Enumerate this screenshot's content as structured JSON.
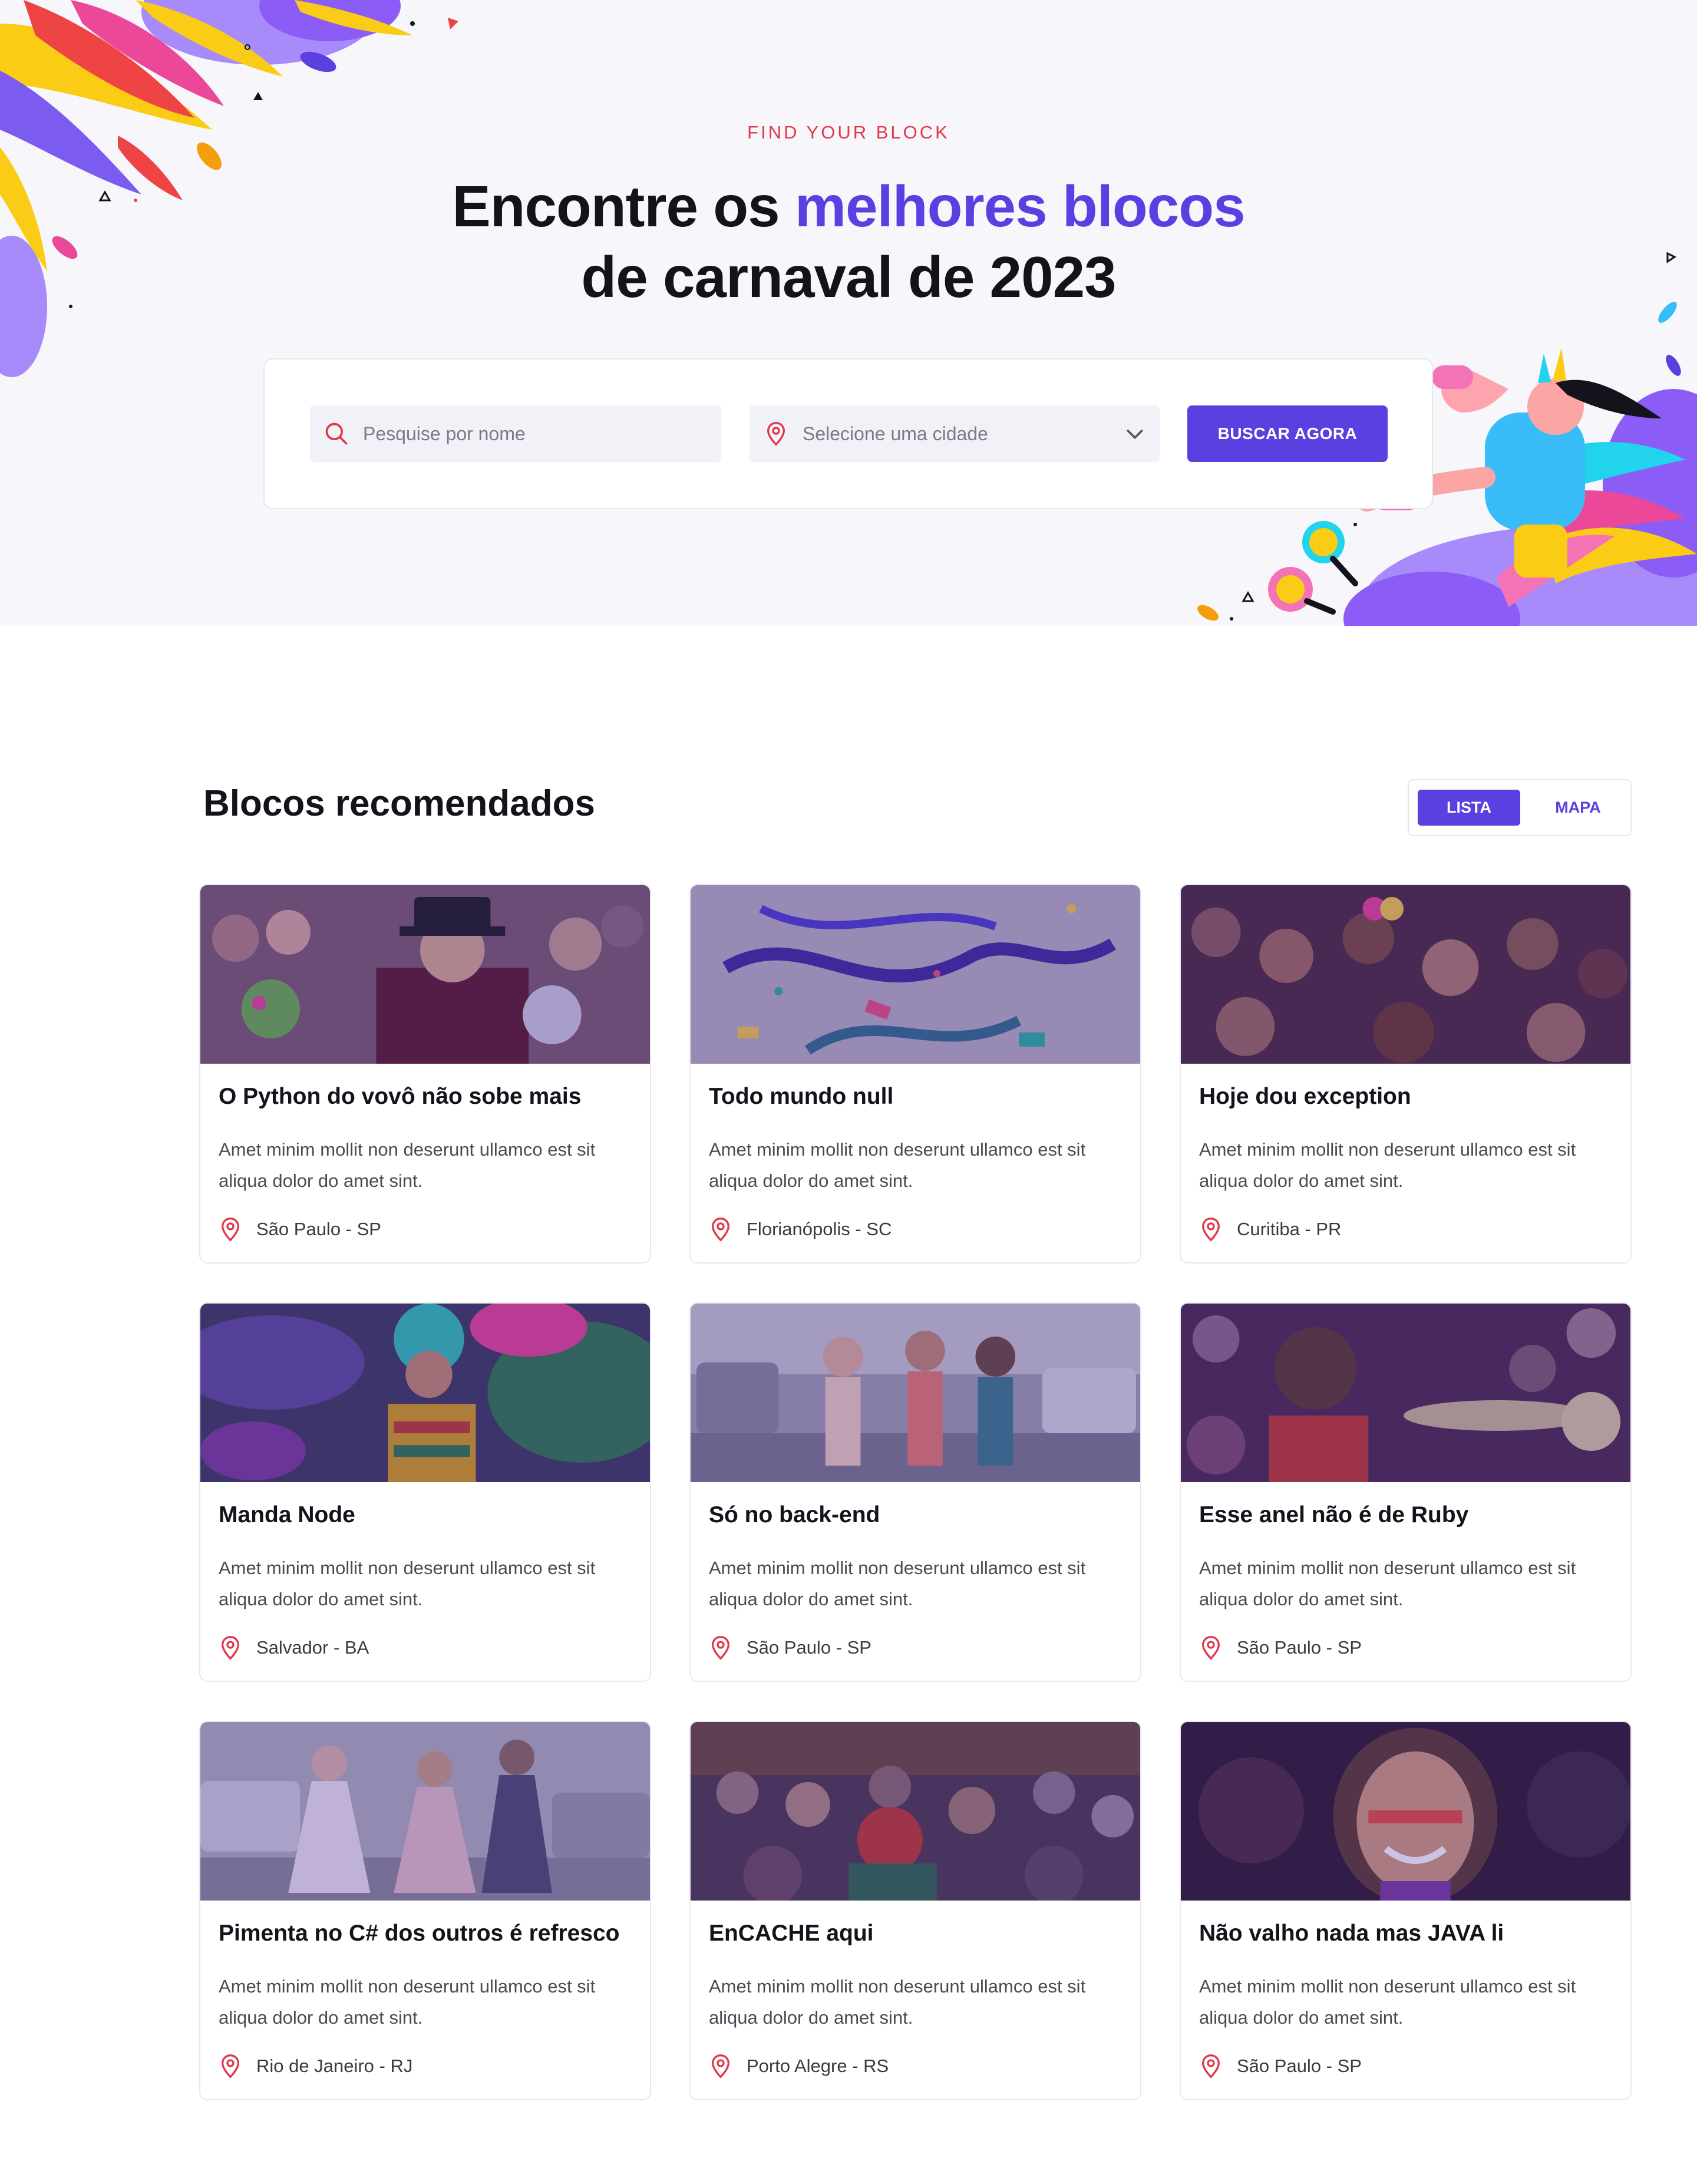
{
  "hero": {
    "eyebrow": "FIND YOUR BLOCK",
    "title_part1": "Encontre os ",
    "title_accent": "melhores blocos",
    "title_line2": "de carnaval de 2023"
  },
  "search": {
    "name_placeholder": "Pesquise por nome",
    "city_placeholder": "Selecione uma cidade",
    "button_label": "BUSCAR AGORA"
  },
  "section": {
    "title": "Blocos recomendados",
    "view_list": "LISTA",
    "view_map": "MAPA"
  },
  "colors": {
    "accent": "#5b3fe0",
    "eyebrow": "#e0384b",
    "pin": "#e0384b"
  },
  "blocks": [
    {
      "title": "O Python do vovô não sobe mais",
      "description": "Amet minim mollit non deserunt ullamco est sit aliqua dolor do amet sint.",
      "location": "São Paulo - SP"
    },
    {
      "title": "Todo mundo null",
      "description": "Amet minim mollit non deserunt ullamco est sit aliqua dolor do amet sint.",
      "location": "Florianópolis - SC"
    },
    {
      "title": "Hoje dou exception",
      "description": "Amet minim mollit non deserunt ullamco est sit aliqua dolor do amet sint.",
      "location": "Curitiba - PR"
    },
    {
      "title": "Manda Node",
      "description": "Amet minim mollit non deserunt ullamco est sit aliqua dolor do amet sint.",
      "location": "Salvador - BA"
    },
    {
      "title": "Só no back-end",
      "description": "Amet minim mollit non deserunt ullamco est sit aliqua dolor do amet sint.",
      "location": "São Paulo - SP"
    },
    {
      "title": "Esse anel não é de Ruby",
      "description": "Amet minim mollit non deserunt ullamco est sit aliqua dolor do amet sint.",
      "location": "São Paulo - SP"
    },
    {
      "title": "Pimenta no C# dos outros é refresco",
      "description": "Amet minim mollit non deserunt ullamco est sit aliqua dolor do amet sint.",
      "location": "Rio de Janeiro - RJ"
    },
    {
      "title": "EnCACHE aqui",
      "description": "Amet minim mollit non deserunt ullamco est sit aliqua dolor do amet sint.",
      "location": "Porto Alegre - RS"
    },
    {
      "title": "Não valho nada mas JAVA li",
      "description": "Amet minim mollit non deserunt ullamco est sit aliqua dolor do amet sint.",
      "location": "São Paulo - SP"
    }
  ]
}
